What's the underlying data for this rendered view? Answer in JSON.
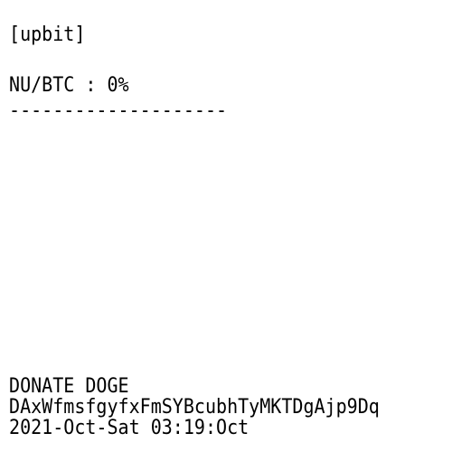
{
  "exchange": "[upbit]",
  "pair_line": "NU/BTC : 0%",
  "divider": "--------------------",
  "donate": {
    "title": "DONATE DOGE",
    "address": "DAxWfmsfgyfxFmSYBcubhTyMKTDgAjp9Dq"
  },
  "timestamp": "2021-Oct-Sat 03:19:Oct",
  "colors": {
    "background": "#ffffff",
    "text": "#000000"
  }
}
